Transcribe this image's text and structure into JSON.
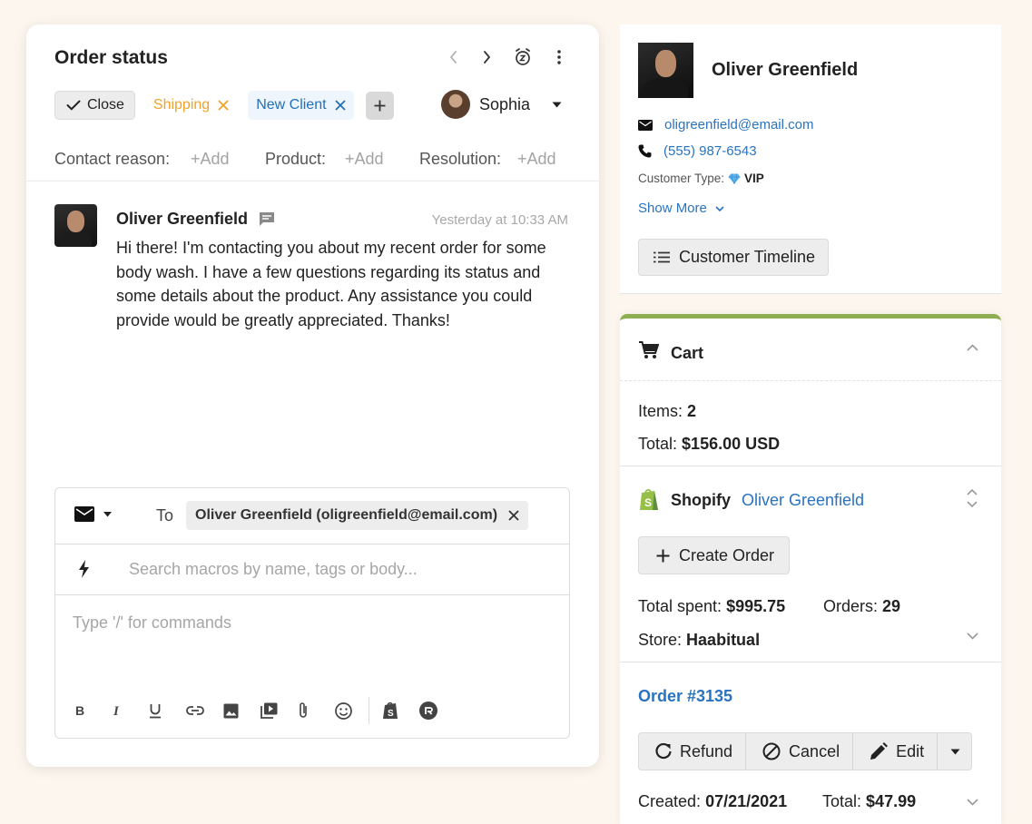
{
  "ticket": {
    "title": "Order status",
    "tags": {
      "close_label": "Close",
      "shipping_label": "Shipping",
      "client_label": "New Client"
    },
    "assignee": "Sophia",
    "fields": {
      "contact_reason_label": "Contact reason:",
      "product_label": "Product:",
      "resolution_label": "Resolution:",
      "add_label": "+Add"
    },
    "message": {
      "author": "Oliver Greenfield",
      "time": "Yesterday at 10:33 AM",
      "body": "Hi there! I'm contacting you about my recent order for some body wash. I have a few questions regarding its status and some details about the product. Any assistance you could provide would be greatly appreciated. Thanks!"
    },
    "composer": {
      "to_label": "To",
      "recipient": "Oliver Greenfield (oligreenfield@email.com)",
      "macro_placeholder": "Search macros by name, tags or body...",
      "body_placeholder": "Type '/' for commands",
      "toolbar_icons": [
        "bold-icon",
        "italic-icon",
        "underline-icon",
        "link-icon",
        "image-icon",
        "video-icon",
        "attachment-icon",
        "emoji-icon",
        "shopify-icon",
        "recharge-icon"
      ]
    }
  },
  "customer": {
    "name": "Oliver Greenfield",
    "email": "oligreenfield@email.com",
    "phone": "(555) 987-6543",
    "type_label": "Customer Type:",
    "type_value": "VIP",
    "show_more": "Show More",
    "timeline_button": "Customer Timeline"
  },
  "cart": {
    "title": "Cart",
    "items_label": "Items:",
    "items_value": "2",
    "total_label": "Total:",
    "total_value": "$156.00 USD"
  },
  "shopify": {
    "label": "Shopify",
    "customer": "Oliver Greenfield",
    "create_order": "Create Order",
    "spent_label": "Total spent:",
    "spent_value": "$995.75",
    "orders_label": "Orders:",
    "orders_value": "29",
    "store_label": "Store:",
    "store_value": "Haabitual"
  },
  "order": {
    "number": "Order #3135",
    "refund": "Refund",
    "cancel": "Cancel",
    "edit": "Edit",
    "created_label": "Created:",
    "created_value": "07/21/2021",
    "total_label": "Total:",
    "total_value": "$47.99"
  },
  "colors": {
    "background": "#fdf6ef",
    "link": "#2a73bf",
    "shipping_tag": "#efa328",
    "client_tag": "#2170b8",
    "shopify_accent": "#8fae52"
  }
}
